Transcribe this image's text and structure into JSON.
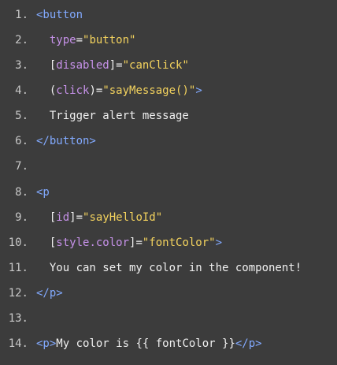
{
  "editor": {
    "lines": [
      {
        "number": "1.",
        "segments": [
          {
            "type": "tag",
            "text": "<button"
          }
        ]
      },
      {
        "number": "2.",
        "segments": [
          {
            "type": "text",
            "text": "  "
          },
          {
            "type": "attr",
            "text": "type"
          },
          {
            "type": "punct",
            "text": "="
          },
          {
            "type": "str",
            "text": "\"button\""
          }
        ]
      },
      {
        "number": "3.",
        "segments": [
          {
            "type": "text",
            "text": "  "
          },
          {
            "type": "punct",
            "text": "["
          },
          {
            "type": "attr",
            "text": "disabled"
          },
          {
            "type": "punct",
            "text": "]="
          },
          {
            "type": "str",
            "text": "\"canClick\""
          }
        ]
      },
      {
        "number": "4.",
        "segments": [
          {
            "type": "text",
            "text": "  "
          },
          {
            "type": "punct",
            "text": "("
          },
          {
            "type": "attr",
            "text": "click"
          },
          {
            "type": "punct",
            "text": ")="
          },
          {
            "type": "str",
            "text": "\"sayMessage()\""
          },
          {
            "type": "tag",
            "text": ">"
          }
        ]
      },
      {
        "number": "5.",
        "segments": [
          {
            "type": "text",
            "text": "  Trigger alert message"
          }
        ]
      },
      {
        "number": "6.",
        "segments": [
          {
            "type": "tag",
            "text": "</button>"
          }
        ]
      },
      {
        "number": "7.",
        "segments": []
      },
      {
        "number": "8.",
        "segments": [
          {
            "type": "tag",
            "text": "<p"
          }
        ]
      },
      {
        "number": "9.",
        "segments": [
          {
            "type": "text",
            "text": "  "
          },
          {
            "type": "punct",
            "text": "["
          },
          {
            "type": "attr",
            "text": "id"
          },
          {
            "type": "punct",
            "text": "]="
          },
          {
            "type": "str",
            "text": "\"sayHelloId\""
          }
        ]
      },
      {
        "number": "10.",
        "segments": [
          {
            "type": "text",
            "text": "  "
          },
          {
            "type": "punct",
            "text": "["
          },
          {
            "type": "attr",
            "text": "style.color"
          },
          {
            "type": "punct",
            "text": "]="
          },
          {
            "type": "str",
            "text": "\"fontColor\""
          },
          {
            "type": "tag",
            "text": ">"
          }
        ]
      },
      {
        "number": "11.",
        "segments": [
          {
            "type": "text",
            "text": "  You can set my color in the component!"
          }
        ]
      },
      {
        "number": "12.",
        "segments": [
          {
            "type": "tag",
            "text": "</p>"
          }
        ]
      },
      {
        "number": "13.",
        "segments": []
      },
      {
        "number": "14.",
        "segments": [
          {
            "type": "tag",
            "text": "<p>"
          },
          {
            "type": "text",
            "text": "My color is {{ fontColor }}"
          },
          {
            "type": "tag",
            "text": "</p>"
          }
        ]
      }
    ]
  },
  "colors": {
    "background": "#3c3c3c",
    "line_number": "#c8c8c8",
    "tag": "#82aaff",
    "attribute": "#c792ea",
    "string": "#f4d35e",
    "text": "#f0f0f0"
  }
}
